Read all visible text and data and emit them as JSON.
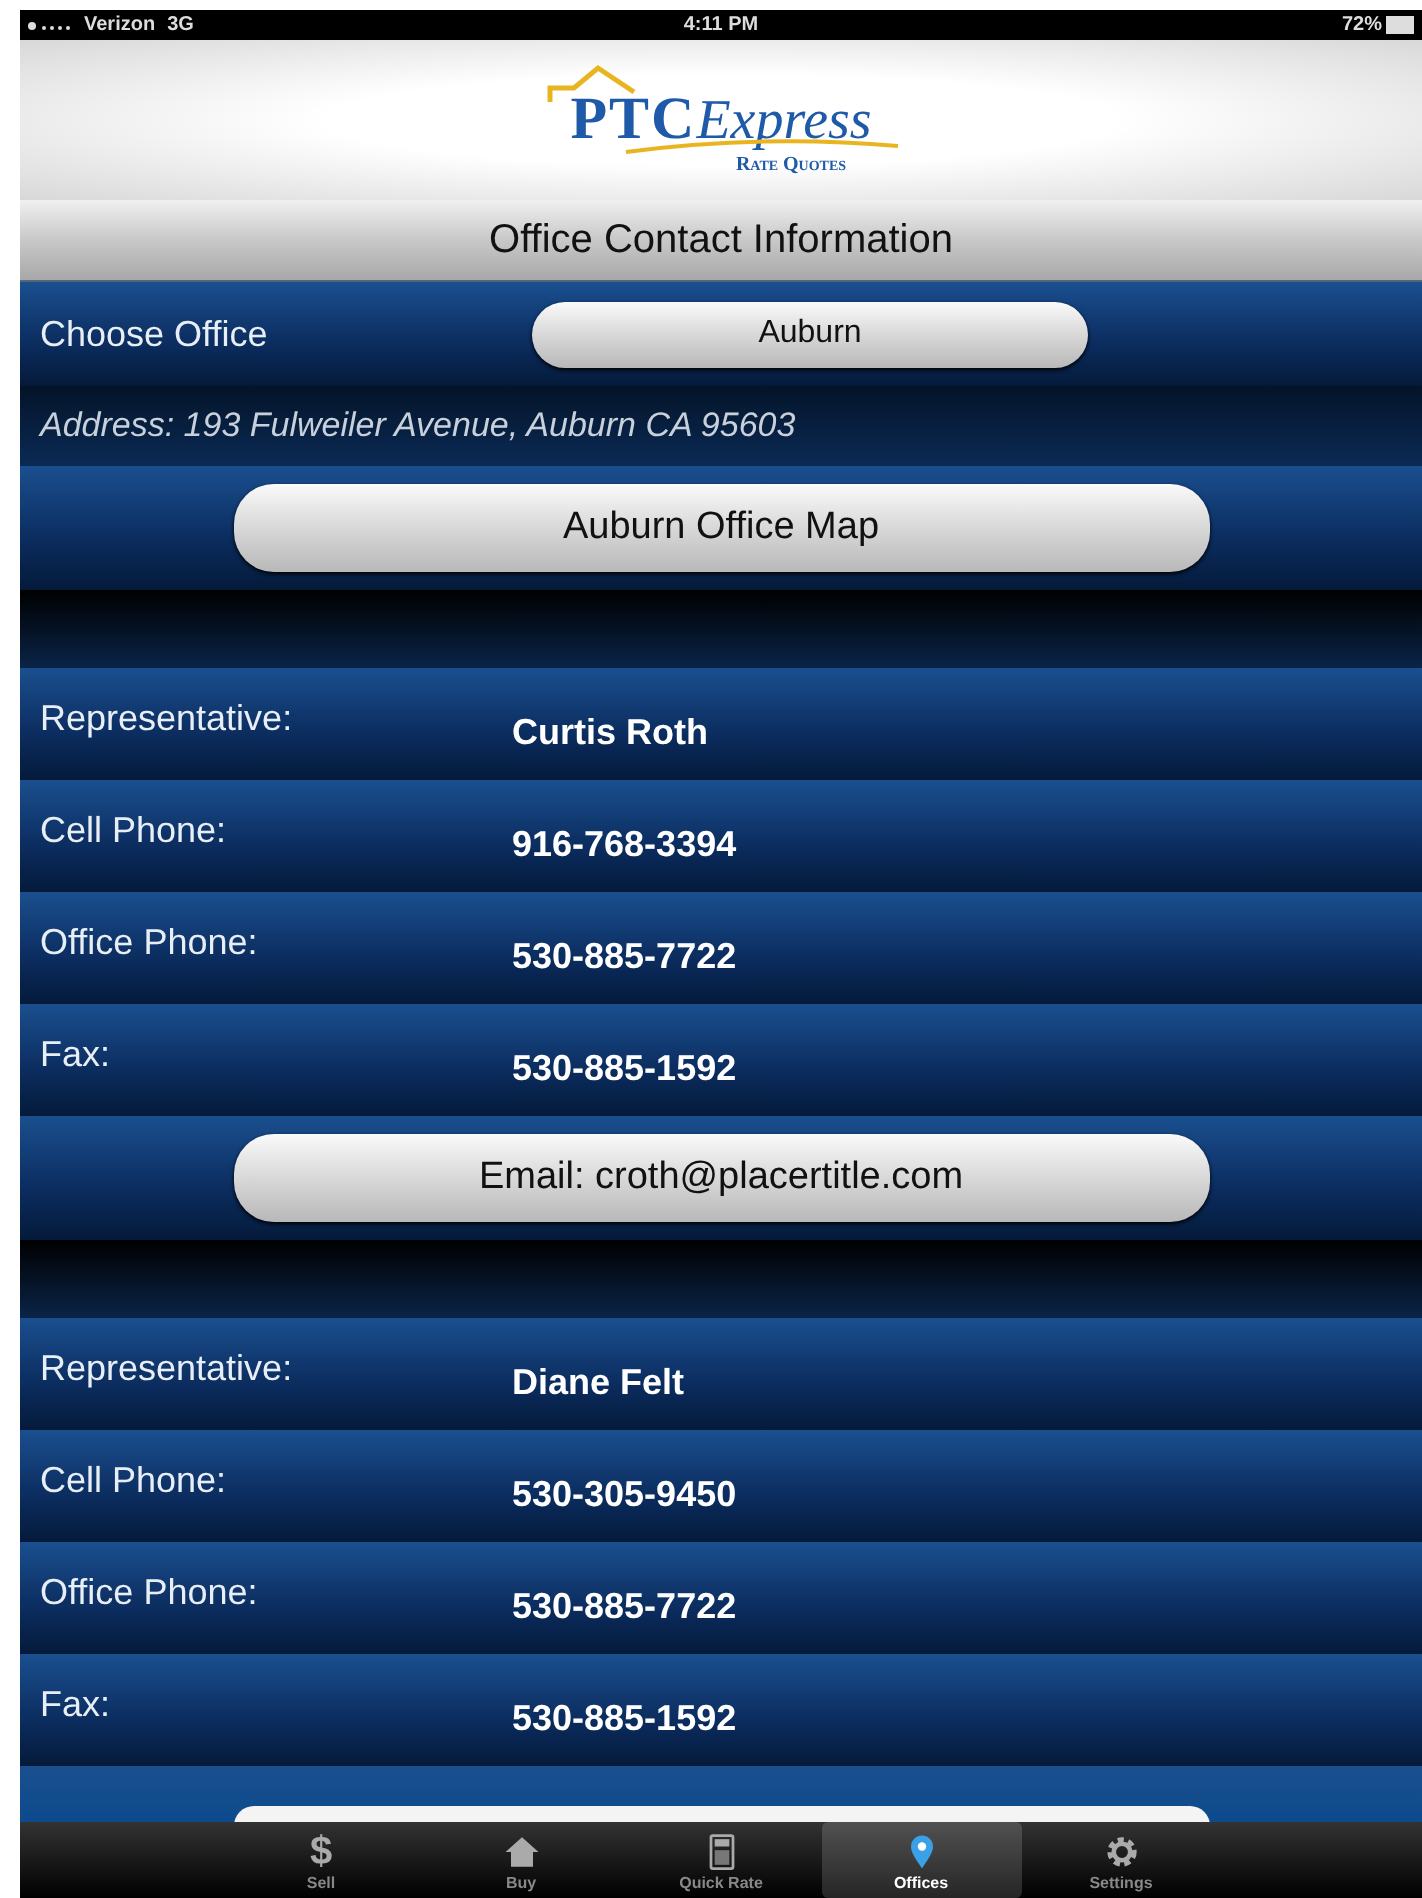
{
  "status_bar": {
    "carrier": "Verizon",
    "network": "3G",
    "time": "4:11 PM",
    "battery": "72%"
  },
  "logo": {
    "brand": "PTC",
    "name": "Express",
    "tagline": "Rate Quotes"
  },
  "title": "Office Contact Information",
  "office_picker": {
    "label": "Choose Office",
    "value": "Auburn"
  },
  "address": "Address: 193 Fulweiler Avenue, Auburn   CA  95603",
  "map_button": "Auburn Office Map",
  "representatives": [
    {
      "fields": [
        {
          "label": "Representative:",
          "value": "Curtis Roth"
        },
        {
          "label": "Cell Phone:",
          "value": "916-768-3394"
        },
        {
          "label": "Office Phone:",
          "value": "530-885-7722"
        },
        {
          "label": "Fax:",
          "value": "530-885-1592"
        }
      ],
      "email_button": "Email: croth@placertitle.com"
    },
    {
      "fields": [
        {
          "label": "Representative:",
          "value": "Diane Felt"
        },
        {
          "label": "Cell Phone:",
          "value": "530-305-9450"
        },
        {
          "label": "Office Phone:",
          "value": "530-885-7722"
        },
        {
          "label": "Fax:",
          "value": "530-885-1592"
        }
      ]
    }
  ],
  "tab_bar": [
    {
      "label": "Sell",
      "symbol": "$",
      "selected": false
    },
    {
      "label": "Buy",
      "selected": false
    },
    {
      "label": "Quick Rate",
      "selected": false
    },
    {
      "label": "Offices",
      "selected": true
    },
    {
      "label": "Settings",
      "selected": false
    }
  ]
}
